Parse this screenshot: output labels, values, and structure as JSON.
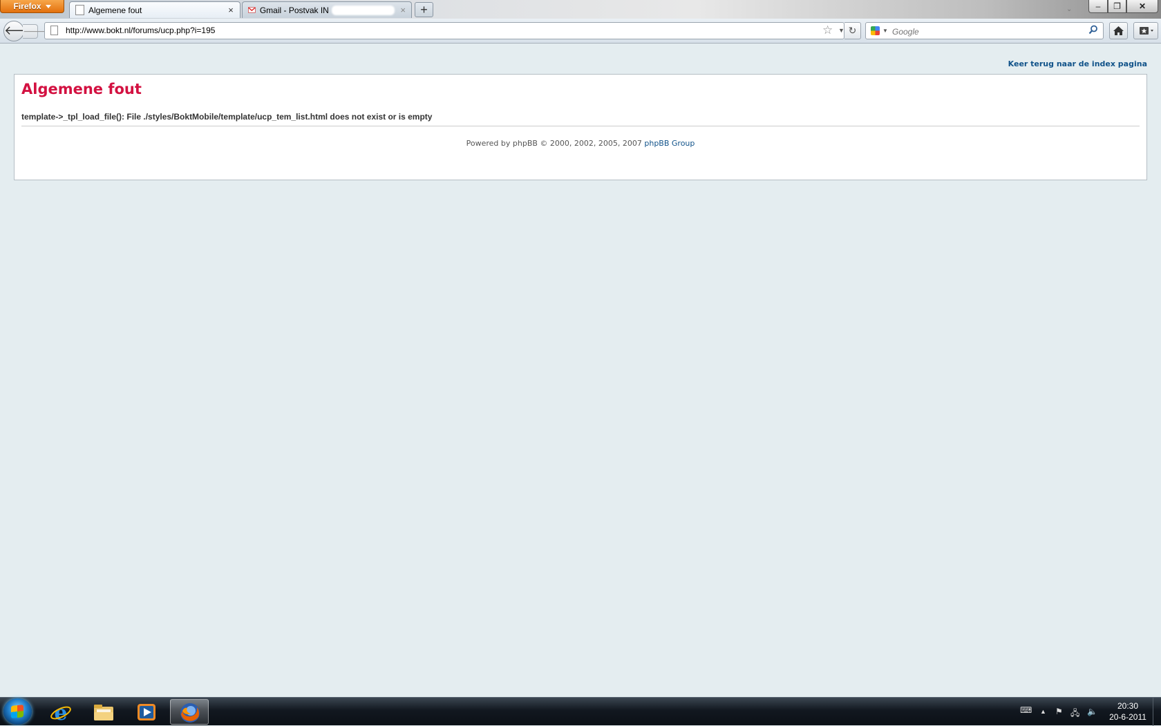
{
  "browser": {
    "menu_button": "Firefox",
    "tabs": [
      {
        "title": "Algemene fout",
        "active": true
      },
      {
        "title": "Gmail - Postvak IN",
        "active": false
      }
    ],
    "new_tab": "+",
    "close_glyph": "×",
    "url": "http://www.bokt.nl/forums/ucp.php?i=195",
    "search_placeholder": "Google",
    "window_controls": {
      "minimize": "–",
      "maximize": "❐",
      "close": "✕"
    }
  },
  "page": {
    "index_link": "Keer terug naar de index pagina",
    "error_title": "Algemene fout",
    "error_message": "template->_tpl_load_file(): File ./styles/BoktMobile/template/ucp_tem_list.html does not exist or is empty",
    "footer_text": "Powered by phpBB © 2000, 2002, 2005, 2007",
    "footer_link": "phpBB Group"
  },
  "taskbar": {
    "pinned": [
      {
        "name": "internet-explorer-icon"
      },
      {
        "name": "file-explorer-icon"
      },
      {
        "name": "media-player-icon"
      },
      {
        "name": "firefox-icon",
        "active": true
      }
    ],
    "clock": {
      "time": "20:30",
      "date": "20-6-2011"
    }
  },
  "colors": {
    "page_background": "#e4edf0",
    "error_title": "#d31141",
    "link": "#105289",
    "firefox_button": "#e8760f"
  }
}
